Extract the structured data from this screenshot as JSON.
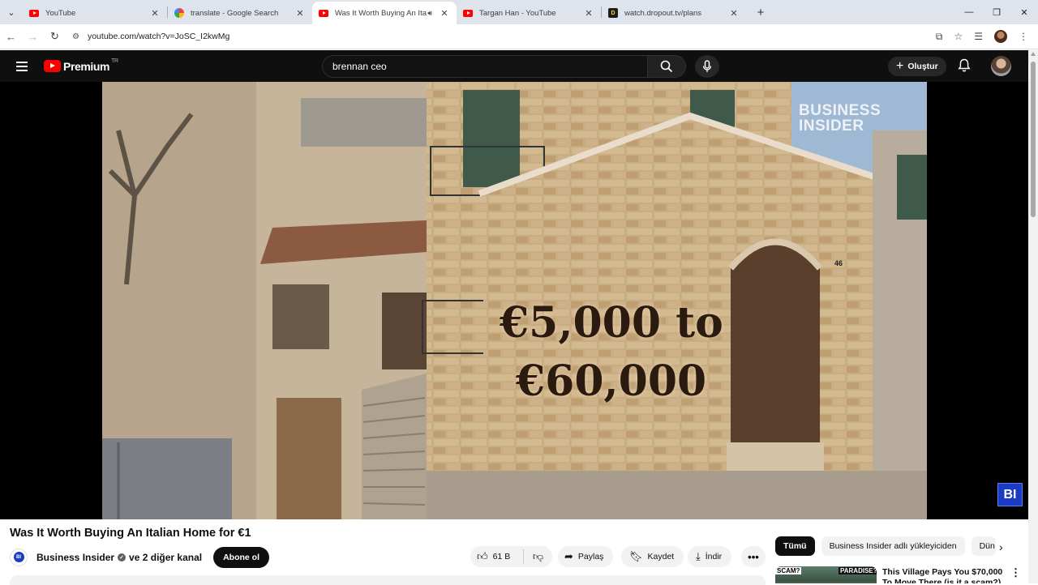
{
  "browser": {
    "tabs": [
      {
        "title": "YouTube",
        "favicon": "youtube-icon",
        "active": false
      },
      {
        "title": "translate - Google Search",
        "favicon": "google-icon",
        "active": false
      },
      {
        "title": "Was It Worth Buying An Ita",
        "favicon": "youtube-icon",
        "active": true,
        "audio": true
      },
      {
        "title": "Targan Han - YouTube",
        "favicon": "youtube-icon",
        "active": false
      },
      {
        "title": "watch.dropout.tv/plans",
        "favicon": "dropout-icon",
        "active": false
      }
    ],
    "url": "youtube.com/watch?v=JoSC_I2kwMg"
  },
  "youtube": {
    "logo_text": "Premium",
    "region": "TR",
    "search_value": "brennan ceo",
    "create_label": "Oluştur"
  },
  "video": {
    "overlay_line1": "€5,000 to",
    "overlay_line2": "€60,000",
    "watermark_line1": "BUSINESS",
    "watermark_line2": "INSIDER",
    "badge": "BI",
    "door_number": "46",
    "title": "Was It Worth Buying An Italian Home for €1"
  },
  "channel": {
    "avatar_text": "BI",
    "name": "Business Insider",
    "others": "ve 2 diğer kanal",
    "subscribe_label": "Abone ol"
  },
  "actions": {
    "likes": "61 B",
    "share": "Paylaş",
    "save": "Kaydet",
    "download": "İndir"
  },
  "chips": [
    "Tümü",
    "Business Insider adlı yükleyiciden",
    "Dün"
  ],
  "recommendation": {
    "thumb_label_1": "SCAM?",
    "thumb_label_2": "PARADISE?",
    "title": "This Village Pays You $70,000 To Move There (is it a scam?)"
  },
  "colors": {
    "brand_red": "#ff0000",
    "bi_blue": "#1a3cc4",
    "header_bg": "#0f0f0f"
  }
}
